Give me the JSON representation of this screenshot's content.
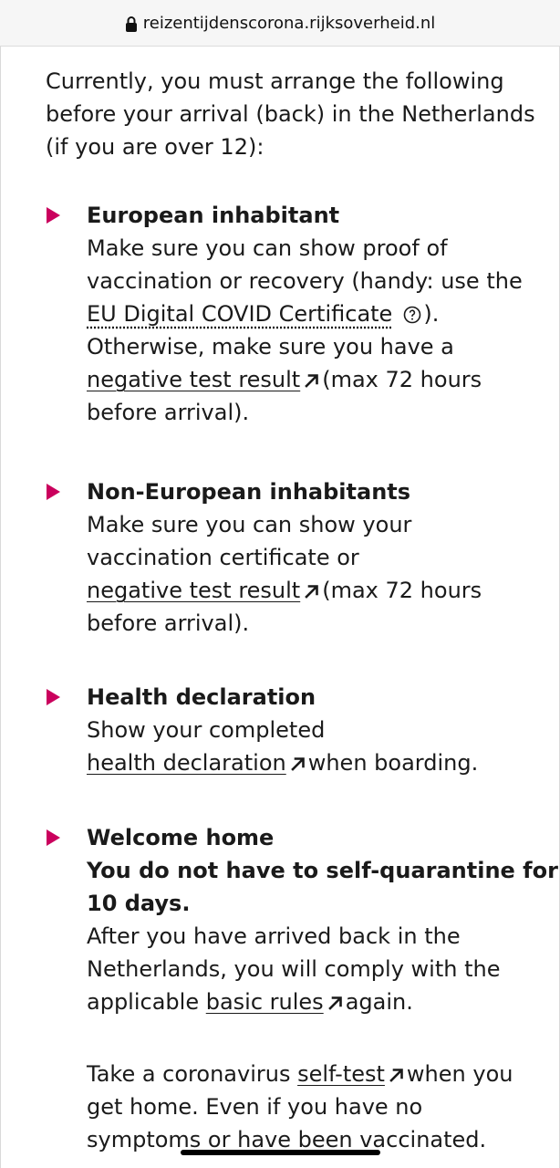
{
  "browser": {
    "url": "reizentijdenscorona.rijksoverheid.nl"
  },
  "intro": [
    "Currently, you must arrange the following",
    "before your arrival (back) in the Netherlands",
    "(if you are over 12):"
  ],
  "items": [
    {
      "title": "European inhabitant",
      "l1": "Make sure you can show proof of",
      "l2": "vaccination or recovery (handy: use the",
      "l3_link": "EU Digital COVID Certificate",
      "l3_after": ").",
      "l4": "Otherwise, make sure you have a",
      "l5_link": "negative test result",
      "l5_after": "(max 72 hours",
      "l6": "before arrival)."
    },
    {
      "title": "Non-European inhabitants",
      "l1": "Make sure you can show your",
      "l2": "vaccination certificate or",
      "l3_link": "negative test result",
      "l3_after": "(max 72 hours",
      "l4": "before arrival)."
    },
    {
      "title": "Health declaration",
      "l1": "Show your completed",
      "l2_link": "health declaration",
      "l2_after": "when boarding."
    },
    {
      "title": "Welcome home",
      "bold1": "You do not have to self-quarantine for",
      "bold2": "10 days.",
      "l1": "After you have arrived back in the",
      "l2": "Netherlands, you will comply with the",
      "l3_before": "applicable",
      "l3_link": "basic rules",
      "l3_after": "again.",
      "p2_l1_before": "Take a coronavirus",
      "p2_l1_link": "self-test",
      "p2_l1_after": "when you",
      "p2_l2": "get home. Even if you have no",
      "p2_l3": "symptoms or have been vaccinated."
    }
  ],
  "colors": {
    "bullet": "#ca005d",
    "text": "#1a1a1a"
  },
  "icons": {
    "lock": "lock-icon",
    "external": "external-link-arrow-icon",
    "help": "help-circle-icon"
  }
}
